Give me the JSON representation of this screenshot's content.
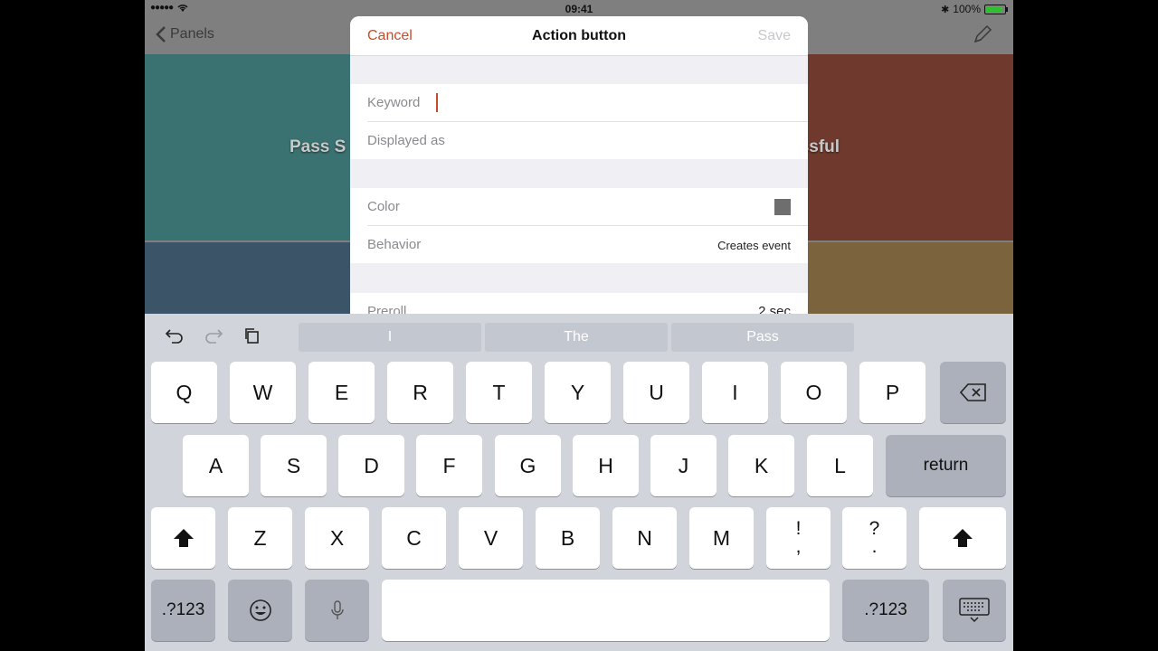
{
  "status": {
    "time": "09:41",
    "battery_percent": "100%",
    "battery_level": 1.0
  },
  "nav": {
    "back_label": "Panels"
  },
  "panels": [
    {
      "label": "Pass S",
      "color": "#3a7271"
    },
    {
      "label": "ccessful",
      "color": "#6f3a2d"
    },
    {
      "label": "",
      "color": "#3c5467"
    },
    {
      "label": "",
      "color": "#7a633d"
    }
  ],
  "modal": {
    "title": "Action button",
    "cancel": "Cancel",
    "save": "Save",
    "keyword_label": "Keyword",
    "displayed_label": "Displayed as",
    "color_label": "Color",
    "color_value": "#6e6e6e",
    "behavior_label": "Behavior",
    "behavior_value": "Creates event",
    "preroll_label": "Preroll",
    "preroll_value": "2 sec"
  },
  "keyboard": {
    "suggestions": [
      "I",
      "The",
      "Pass"
    ],
    "row1": [
      "Q",
      "W",
      "E",
      "R",
      "T",
      "Y",
      "U",
      "I",
      "O",
      "P"
    ],
    "row2": [
      "A",
      "S",
      "D",
      "F",
      "G",
      "H",
      "J",
      "K",
      "L"
    ],
    "row3": [
      "Z",
      "X",
      "C",
      "V",
      "B",
      "N",
      "M"
    ],
    "return_label": "return",
    "numbers_label": ".?123",
    "punct1": [
      "!",
      ","
    ],
    "punct2": [
      "?",
      "."
    ]
  },
  "colors": {
    "accent": "#cc4a2a"
  }
}
